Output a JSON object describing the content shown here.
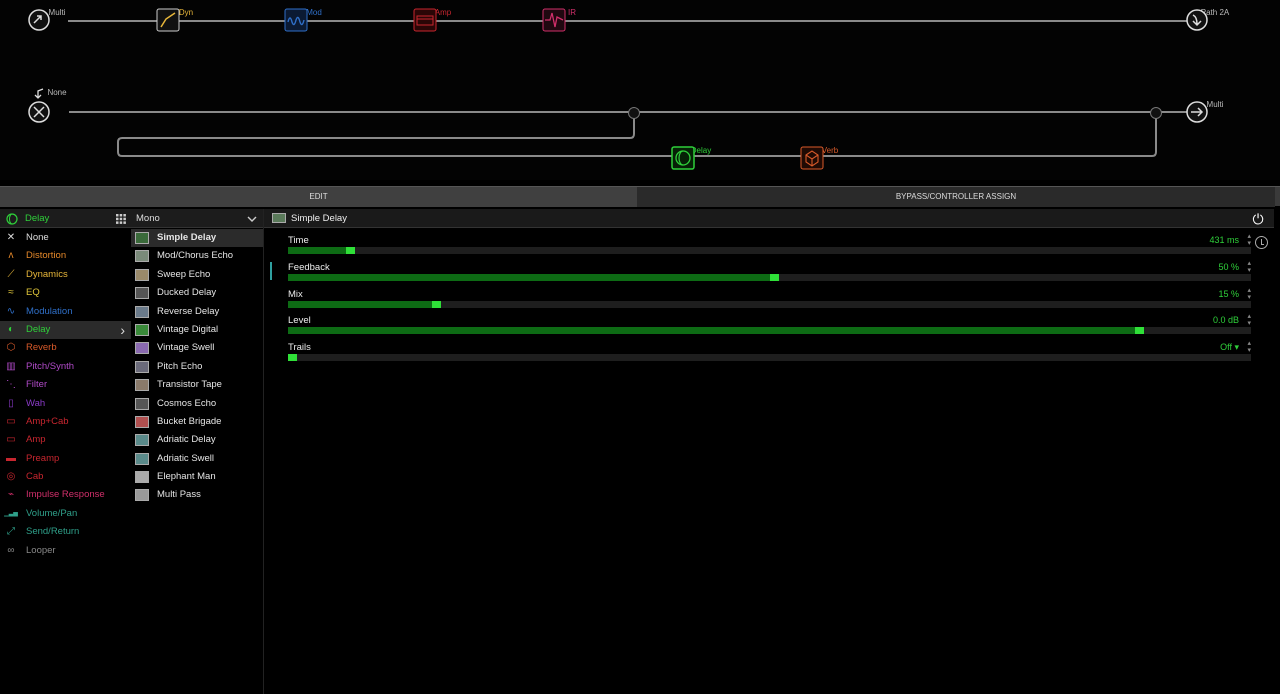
{
  "colors": {
    "green": "#2fd03a",
    "dyn": "#e8b73a",
    "mod": "#2f6fc8",
    "amp": "#c8262f",
    "ir": "#d02f6a",
    "verb": "#d85a2a"
  },
  "signal_flow": {
    "path1": {
      "input": {
        "label": "Multi",
        "icon": "multi-input-icon"
      },
      "blocks": [
        {
          "label": "Dyn",
          "icon": "dynamics-icon"
        },
        {
          "label": "Mod",
          "icon": "modulation-icon"
        },
        {
          "label": "Amp",
          "icon": "amp-icon"
        },
        {
          "label": "IR",
          "icon": "impulse-response-icon"
        }
      ],
      "output": {
        "label": "Path 2A",
        "icon": "path-output-icon"
      }
    },
    "path2": {
      "input": {
        "label": "None",
        "icon": "none-input-icon"
      },
      "blocks": [
        {
          "label": "Delay",
          "icon": "delay-icon"
        },
        {
          "label": "Verb",
          "icon": "reverb-icon"
        }
      ],
      "output": {
        "label": "Multi",
        "icon": "output-arrow-icon"
      }
    }
  },
  "tabs": {
    "edit": "EDIT",
    "bypass": "BYPASS/CONTROLLER ASSIGN"
  },
  "category_header": {
    "label": "Delay",
    "icon": "delay-icon",
    "grid_icon": "grid-icon"
  },
  "model_header": {
    "label": "Mono",
    "icon": "chevron-down-icon"
  },
  "categories": [
    {
      "label": "None",
      "icon": "none-icon"
    },
    {
      "label": "Distortion",
      "icon": "distortion-icon"
    },
    {
      "label": "Dynamics",
      "icon": "dynamics-icon"
    },
    {
      "label": "EQ",
      "icon": "eq-icon"
    },
    {
      "label": "Modulation",
      "icon": "modulation-icon"
    },
    {
      "label": "Delay",
      "icon": "delay-icon"
    },
    {
      "label": "Reverb",
      "icon": "reverb-icon"
    },
    {
      "label": "Pitch/Synth",
      "icon": "pitch-synth-icon"
    },
    {
      "label": "Filter",
      "icon": "filter-icon"
    },
    {
      "label": "Wah",
      "icon": "wah-icon"
    },
    {
      "label": "Amp+Cab",
      "icon": "amp-cab-icon"
    },
    {
      "label": "Amp",
      "icon": "amp-icon"
    },
    {
      "label": "Preamp",
      "icon": "preamp-icon"
    },
    {
      "label": "Cab",
      "icon": "cab-icon"
    },
    {
      "label": "Impulse Response",
      "icon": "impulse-response-icon"
    },
    {
      "label": "Volume/Pan",
      "icon": "volume-pan-icon"
    },
    {
      "label": "Send/Return",
      "icon": "send-return-icon"
    },
    {
      "label": "Looper",
      "icon": "looper-icon"
    }
  ],
  "models": [
    "Simple Delay",
    "Mod/Chorus Echo",
    "Sweep Echo",
    "Ducked Delay",
    "Reverse Delay",
    "Vintage Digital",
    "Vintage Swell",
    "Pitch Echo",
    "Transistor Tape",
    "Cosmos Echo",
    "Bucket Brigade",
    "Adriatic Delay",
    "Adriatic Swell",
    "Elephant Man",
    "Multi Pass"
  ],
  "params_panel": {
    "title": "Simple Delay",
    "power_icon": "power-icon",
    "clock_icon": "clock-icon"
  },
  "params": [
    {
      "name": "Time",
      "value": "431 ms",
      "level": 0.06
    },
    {
      "name": "Feedback",
      "value": "50 %",
      "level": 0.5
    },
    {
      "name": "Mix",
      "value": "15 %",
      "level": 0.15
    },
    {
      "name": "Level",
      "value": "0.0 dB",
      "level": 0.88
    },
    {
      "name": "Trails",
      "value": "Off",
      "level": 0.0
    }
  ]
}
